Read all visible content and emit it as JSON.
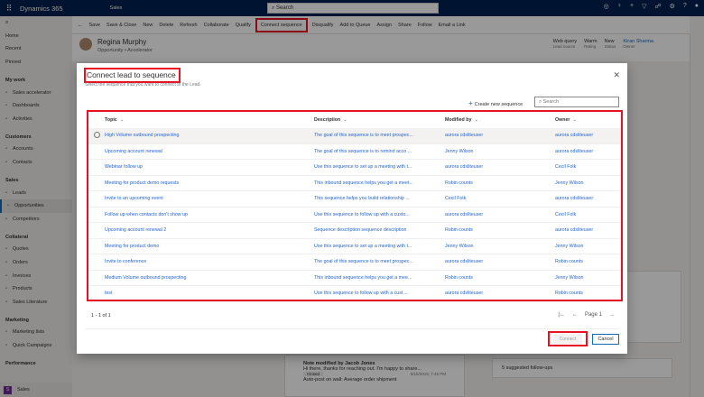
{
  "topbar": {
    "app": "Dynamics 365",
    "area": "Sales",
    "search_placeholder": "Search"
  },
  "command_bar": [
    "Save",
    "Save & Close",
    "New",
    "Delete",
    "Refresh",
    "Collaborate",
    "Qualify",
    "Connect sequence",
    "Disqualify",
    "Add to Queue",
    "Assign",
    "Share",
    "Follow",
    "Email a Link"
  ],
  "sidebar": {
    "top": [
      "Home",
      "Recent",
      "Pinned"
    ],
    "groups": [
      {
        "title": "My work",
        "items": [
          "Sales accelerator",
          "Dashboards",
          "Activities"
        ]
      },
      {
        "title": "Customers",
        "items": [
          "Accounts",
          "Contacts"
        ]
      },
      {
        "title": "Sales",
        "items": [
          "Leads",
          "Opportunities",
          "Competitors"
        ]
      },
      {
        "title": "Collateral",
        "items": [
          "Quotes",
          "Orders",
          "Invoices",
          "Products",
          "Sales Literature"
        ]
      },
      {
        "title": "Marketing",
        "items": [
          "Marketing lists",
          "Quick Campaigns"
        ]
      },
      {
        "title": "Performance",
        "items": []
      }
    ],
    "active": "Opportunities",
    "area_switcher": {
      "badge": "S",
      "label": "Sales"
    }
  },
  "record": {
    "name": "Regina Murphy",
    "subtitle": "Opportunity • Accelerator",
    "fields": [
      {
        "value": "Web query",
        "label": "Lead source"
      },
      {
        "value": "Warm",
        "label": "Rating"
      },
      {
        "value": "New",
        "label": "Status"
      },
      {
        "value": "Kiran Sharma",
        "label": "Owner"
      }
    ]
  },
  "timeline": {
    "note_title": "Note modified by Jacob Jones",
    "note_text": "Hi there, thanks for reaching out. I'm happy to share...",
    "note_badge": "Closed",
    "note_time": "6/15/2019, 7:45 PM",
    "next": "Auto-post on wall: Average order shipment"
  },
  "followups": "5 suggested follow-ups",
  "dialog": {
    "title": "Connect lead to sequence",
    "description": "Select the sequence that you want to connect to the Lead.",
    "create_label": "Create new sequence",
    "search_placeholder": "Search",
    "columns": [
      "Topic",
      "Description",
      "Modified by",
      "Owner"
    ],
    "rows": [
      [
        "High Volume outbound prospecting",
        "The goal of this sequence is to meet prospec...",
        "aurora cdsliteuser",
        "aurora cdsliteuser"
      ],
      [
        "Upcoming account renewal",
        "The goal of this sequence is to remind acco ...",
        "Jenny Wilson",
        "aurora cdsliteuser"
      ],
      [
        "Webinar follow up",
        "Use this sequence to set up a meeting with t...",
        "aurora cdsliteuser",
        "Cecil Folk"
      ],
      [
        "Meeting for product demo requests",
        "This inbound sequence helps you get a meet...",
        "Robin counts",
        "Jenny Wilson"
      ],
      [
        "Invite to an upcoming event",
        "This sequence helps you build relationship ...",
        "Cecil Folk",
        "aurora cdsliteuser"
      ],
      [
        "Follow up when contacts don't show up",
        "Use this sequence to follow up with a custo...",
        "aurora cdsliteuser",
        "Cecil Folk"
      ],
      [
        "Upcoming account renewal 2",
        "Sequence description sequence description",
        "Robin counts",
        "aurora cdsliteuser"
      ],
      [
        "Meeting for product demo",
        "Use this sequence to set up a meeting with t...",
        "Jenny Wilson",
        "Jenny Wilson"
      ],
      [
        "Invite to conference",
        "The goal of this sequence is to meet prospec...",
        "aurora cdsliteuser",
        "Robin counts"
      ],
      [
        "Medium Volume outbound prospecting",
        "This inbound sequence helps you get a mee...",
        "Robin counts",
        "Jenny Wilson"
      ],
      [
        "test",
        "Use this sequence to follow up with a cust ...",
        "aurora cdsliteuser",
        "Robin counts"
      ]
    ],
    "count": "1 - 1 of 1",
    "page": "Page 1",
    "connect_label": "Connect",
    "cancel_label": "Cancel"
  },
  "colors": {
    "nav": "#002050",
    "accent": "#0f6cbd",
    "highlight": "#e81123",
    "link": "#2266cc"
  }
}
